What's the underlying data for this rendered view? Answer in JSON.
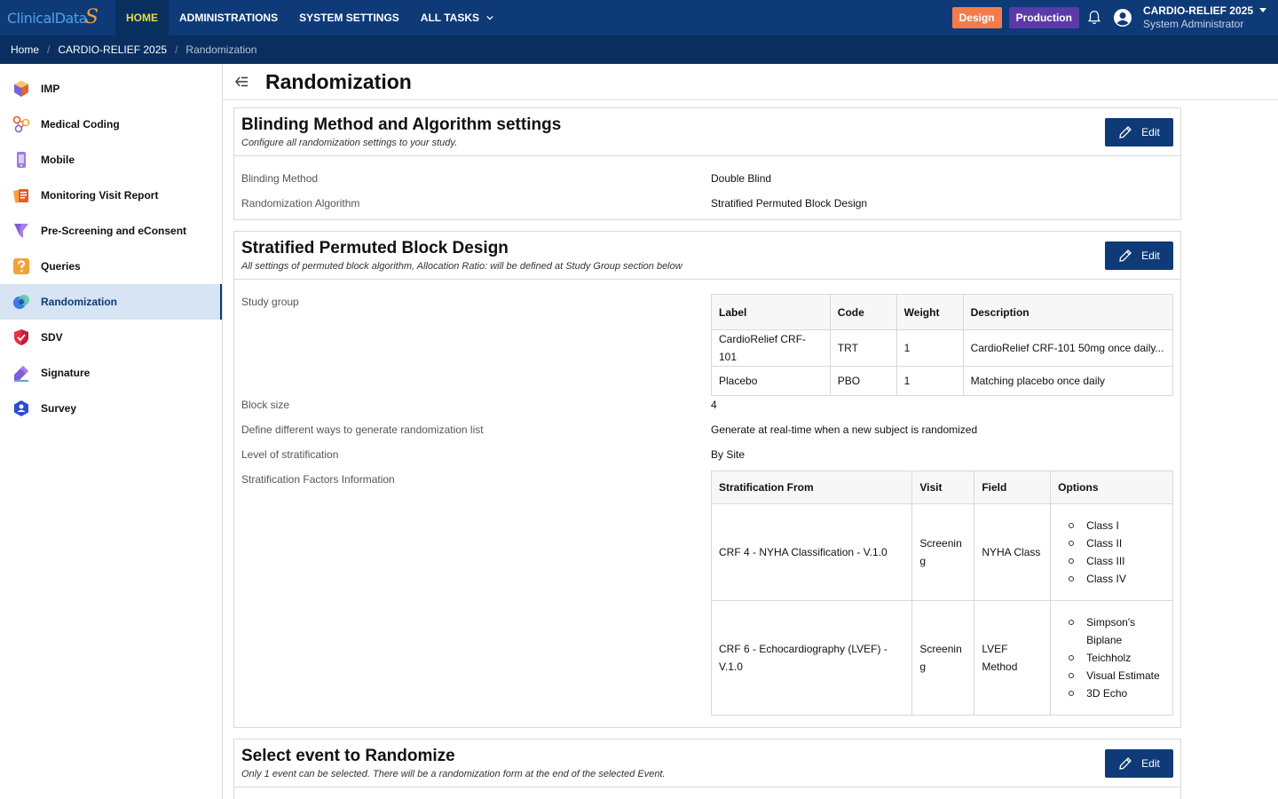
{
  "brand": {
    "logo_text": "ClinicalData",
    "logo_swash": "S"
  },
  "nav": {
    "items": [
      {
        "label": "HOME"
      },
      {
        "label": "ADMINISTRATIONS"
      },
      {
        "label": "SYSTEM SETTINGS"
      },
      {
        "label": "ALL TASKS"
      }
    ],
    "design_label": "Design",
    "production_label": "Production",
    "user_name": "CARDIO-RELIEF 2025",
    "user_role": "System Administrator"
  },
  "breadcrumb": [
    "Home",
    "CARDIO-RELIEF 2025",
    "Randomization"
  ],
  "sidebar": {
    "items": [
      {
        "label": "IMP",
        "icon": "cube-icon"
      },
      {
        "label": "Medical Coding",
        "icon": "molecule-icon"
      },
      {
        "label": "Mobile",
        "icon": "mobile-icon"
      },
      {
        "label": "Monitoring Visit Report",
        "icon": "report-icon"
      },
      {
        "label": "Pre-Screening and eConsent",
        "icon": "funnel-icon"
      },
      {
        "label": "Queries",
        "icon": "question-icon"
      },
      {
        "label": "Randomization",
        "icon": "randomization-icon"
      },
      {
        "label": "SDV",
        "icon": "shield-icon"
      },
      {
        "label": "Signature",
        "icon": "pen-icon"
      },
      {
        "label": "Survey",
        "icon": "survey-icon"
      }
    ]
  },
  "page": {
    "title": "Randomization"
  },
  "blinding": {
    "title": "Blinding Method and Algorithm settings",
    "subtitle": "Configure all randomization settings to your study.",
    "edit_label": "Edit",
    "method_label": "Blinding Method",
    "method_value": "Double Blind",
    "algo_label": "Randomization Algorithm",
    "algo_value": "Stratified Permuted Block Design"
  },
  "spbd": {
    "title": "Stratified Permuted Block Design",
    "subtitle": "All settings of permuted block algorithm, Allocation Ratio: will be defined at Study Group section below",
    "edit_label": "Edit",
    "study_group_label": "Study group",
    "group_headers": [
      "Label",
      "Code",
      "Weight",
      "Description"
    ],
    "group_rows": [
      [
        "CardioRelief CRF-101",
        "TRT",
        "1",
        "CardioRelief CRF-101 50mg once daily..."
      ],
      [
        "Placebo",
        "PBO",
        "1",
        "Matching placebo once daily"
      ]
    ],
    "block_size_label": "Block size",
    "block_size_value": "4",
    "gen_label": "Define different ways to generate randomization list",
    "gen_value": "Generate at real-time when a new subject is randomized",
    "level_label": "Level of stratification",
    "level_value": "By Site",
    "factors_label": "Stratification Factors Information",
    "factor_headers": [
      "Stratification From",
      "Visit",
      "Field",
      "Options"
    ],
    "factor_rows": [
      {
        "from": "CRF 4 - NYHA Classification - V.1.0",
        "visit": "Screenin g",
        "field": "NYHA Class",
        "options": [
          "Class I",
          "Class II",
          "Class III",
          "Class IV"
        ]
      },
      {
        "from": "CRF 6 - Echocardiography (LVEF) - V.1.0",
        "visit": "Screenin g",
        "field": "LVEF Method",
        "options": [
          "Simpson's Biplane",
          "Teichholz",
          "Visual Estimate",
          "3D Echo"
        ]
      }
    ]
  },
  "event": {
    "title": "Select event to Randomize",
    "subtitle": "Only 1 event can be selected. There will be a randomization form at the end of the selected Event.",
    "edit_label": "Edit"
  }
}
